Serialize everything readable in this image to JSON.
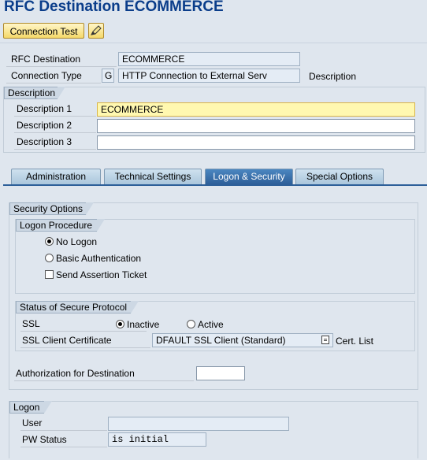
{
  "window": {
    "title": "RFC Destination ECOMMERCE"
  },
  "toolbar": {
    "connection_test_label": "Connection Test"
  },
  "header": {
    "rfc_destination_label": "RFC Destination",
    "rfc_destination_value": "ECOMMERCE",
    "connection_type_label": "Connection Type",
    "connection_type_code": "G",
    "connection_type_value": "HTTP Connection to External Serv",
    "description_label": "Description"
  },
  "description_group": {
    "title": "Description",
    "desc1_label": "Description 1",
    "desc1_value": "ECOMMERCE",
    "desc2_label": "Description 2",
    "desc2_value": "",
    "desc3_label": "Description 3",
    "desc3_value": ""
  },
  "tabs": [
    {
      "label": "Administration"
    },
    {
      "label": "Technical Settings"
    },
    {
      "label": "Logon & Security"
    },
    {
      "label": "Special Options"
    }
  ],
  "security_options": {
    "title": "Security Options",
    "logon_procedure": {
      "title": "Logon Procedure",
      "no_logon": "No Logon",
      "basic_auth": "Basic Authentication",
      "send_assertion": "Send Assertion Ticket",
      "selected": "No Logon"
    },
    "secure_protocol": {
      "title": "Status of Secure Protocol",
      "ssl_label": "SSL",
      "inactive": "Inactive",
      "active": "Active",
      "selected": "Inactive",
      "cert_label": "SSL Client Certificate",
      "cert_value": "DFAULT SSL Client (Standard)",
      "cert_list": "Cert. List"
    },
    "auth_label": "Authorization for Destination",
    "auth_value": ""
  },
  "logon": {
    "title": "Logon",
    "user_label": "User",
    "user_value": "",
    "pw_label": "PW Status",
    "pw_value": "is initial"
  }
}
